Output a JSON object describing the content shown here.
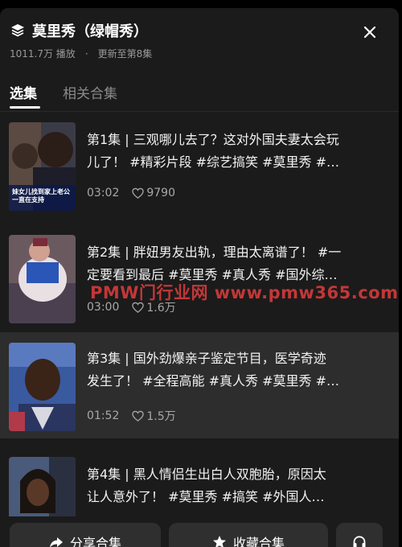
{
  "header": {
    "title": "莫里秀（绿帽秀）",
    "plays": "1011.7万 播放",
    "separator": "·",
    "update": "更新至第8集"
  },
  "tabs": [
    {
      "label": "选集",
      "active": true
    },
    {
      "label": "相关合集",
      "active": false
    }
  ],
  "episodes": [
    {
      "line1": "第1集 | 三观哪儿去了？这对外国夫妻太会玩",
      "line2": "儿了！ #精彩片段 #综艺搞笑 #莫里秀 #…",
      "duration": "03:02",
      "likes": "9790",
      "thumb_caption": "妹女儿找到家上老公一直在支持",
      "selected": false
    },
    {
      "line1": "第2集 | 胖妞男友出轨，理由太离谱了！ #一",
      "line2": "定要看到最后 #莫里秀 #真人秀 #国外综…",
      "duration": "03:00",
      "likes": "1.6万",
      "selected": false
    },
    {
      "line1": "第3集 | 国外劲爆亲子鉴定节目，医学奇迹",
      "line2": "发生了！ #全程高能 #真人秀 #莫里秀 #…",
      "duration": "01:52",
      "likes": "1.5万",
      "selected": true
    },
    {
      "line1": "第4集 | 黑人情侣生出白人双胞胎，原因太",
      "line2": "让人意外了！ #莫里秀 #搞笑 #外国人…",
      "selected": false
    }
  ],
  "watermark": "PMW门行业网 www.pmw365.com",
  "bottom": {
    "share_label": "分享合集",
    "collect_label": "收藏合集"
  },
  "icons": {
    "title": "stack-layers-icon",
    "close": "close-icon",
    "like": "heart-icon",
    "share": "share-arrow-icon",
    "collect": "star-icon",
    "listen": "headphones-icon"
  },
  "colors": {
    "sheet_bg": "#1b1b1b",
    "selected_row": "#2d2d2d",
    "button_bg": "#2f2f2f",
    "watermark": "#d23a3a"
  }
}
